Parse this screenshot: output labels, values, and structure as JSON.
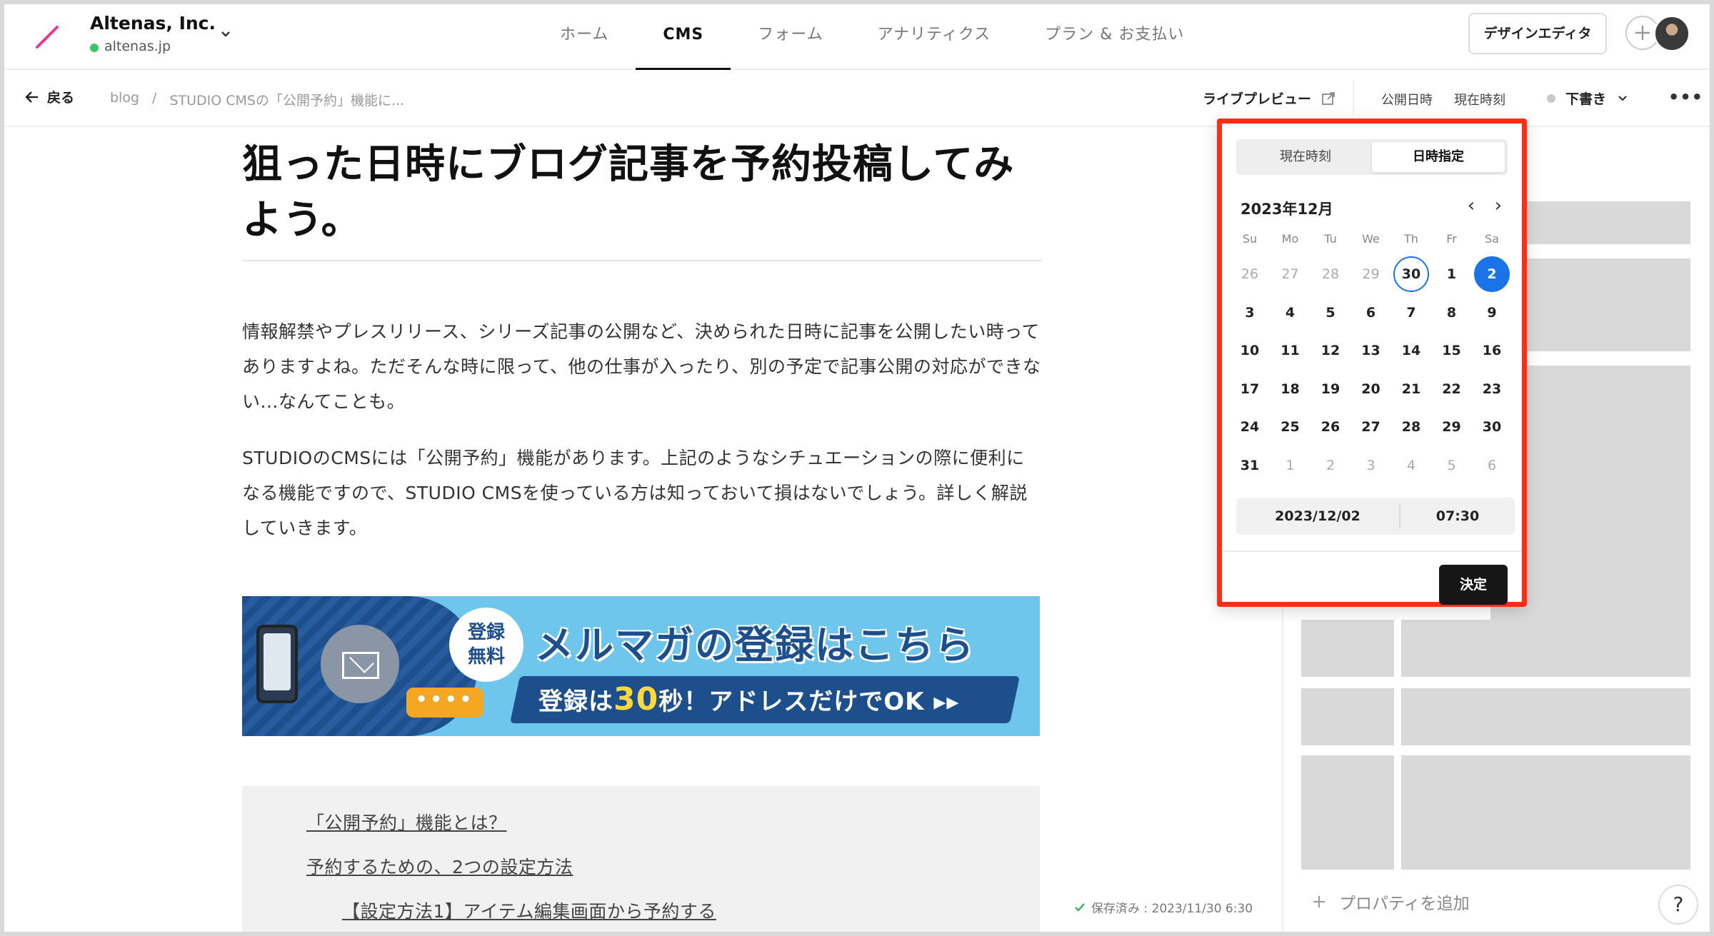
{
  "header": {
    "org_name": "Altenas, Inc.",
    "org_domain": "altenas.jp",
    "nav": [
      "ホーム",
      "CMS",
      "フォーム",
      "アナリティクス",
      "プラン & お支払い"
    ],
    "design_editor": "デザインエディタ"
  },
  "subbar": {
    "back": "戻る",
    "crumb_root": "blog",
    "crumb_sep": "/",
    "crumb_page": "STUDIO CMSの「公開予約」機能に...",
    "live_preview": "ライブプレビュー",
    "publish_date": "公開日時",
    "now": "現在時刻",
    "status": "下書き",
    "more": "•••"
  },
  "article": {
    "title": "狙った日時にブログ記事を予約投稿してみよう。",
    "para1": "情報解禁やプレスリリース、シリーズ記事の公開など、決められた日時に記事を公開したい時ってありますよね。ただそんな時に限って、他の仕事が入ったり、別の予定で記事公開の対応ができない...なんてことも。",
    "para2": "STUDIOのCMSには「公開予約」機能があります。上記のようなシチュエーションの際に便利になる機能ですので、STUDIO CMSを使っている方は知っておいて損はないでしょう。詳しく解説していきます。"
  },
  "banner": {
    "badge": "登録\n無料",
    "title": "メルマガの登録はこちら",
    "sub_a": "登録は",
    "sub_b": "30",
    "sub_c": "秒！アドレスだけでOK ▸▸",
    "dots": "••••"
  },
  "toc": [
    "「公開予約」機能とは？",
    "予約するための、2つの設定方法",
    "【設定方法1】アイテム編集画面から予約する"
  ],
  "saved": "保存済み : 2023/11/30 6:30",
  "panel": {
    "add_property": "プロパティを追加",
    "help": "?"
  },
  "picker": {
    "tabs": [
      "現在時刻",
      "日時指定"
    ],
    "active_tab": 1,
    "month_label": "2023年12月",
    "weekdays": [
      "Su",
      "Mo",
      "Tu",
      "We",
      "Th",
      "Fr",
      "Sa"
    ],
    "weeks": [
      [
        {
          "d": "26",
          "o": true
        },
        {
          "d": "27",
          "o": true
        },
        {
          "d": "28",
          "o": true
        },
        {
          "d": "29",
          "o": true
        },
        {
          "d": "30",
          "today": true
        },
        {
          "d": "1"
        },
        {
          "d": "2",
          "sel": true
        }
      ],
      [
        {
          "d": "3"
        },
        {
          "d": "4"
        },
        {
          "d": "5"
        },
        {
          "d": "6"
        },
        {
          "d": "7"
        },
        {
          "d": "8"
        },
        {
          "d": "9"
        }
      ],
      [
        {
          "d": "10"
        },
        {
          "d": "11"
        },
        {
          "d": "12"
        },
        {
          "d": "13"
        },
        {
          "d": "14"
        },
        {
          "d": "15"
        },
        {
          "d": "16"
        }
      ],
      [
        {
          "d": "17"
        },
        {
          "d": "18"
        },
        {
          "d": "19"
        },
        {
          "d": "20"
        },
        {
          "d": "21"
        },
        {
          "d": "22"
        },
        {
          "d": "23"
        }
      ],
      [
        {
          "d": "24"
        },
        {
          "d": "25"
        },
        {
          "d": "26"
        },
        {
          "d": "27"
        },
        {
          "d": "28"
        },
        {
          "d": "29"
        },
        {
          "d": "30"
        }
      ],
      [
        {
          "d": "31"
        },
        {
          "d": "1",
          "o": true
        },
        {
          "d": "2",
          "o": true
        },
        {
          "d": "3",
          "o": true
        },
        {
          "d": "4",
          "o": true
        },
        {
          "d": "5",
          "o": true
        },
        {
          "d": "6",
          "o": true
        }
      ]
    ],
    "date_value": "2023/12/02",
    "time_value": "07:30",
    "confirm": "決定",
    "accent": "#1a73e8",
    "highlight": "#ff2d16"
  }
}
